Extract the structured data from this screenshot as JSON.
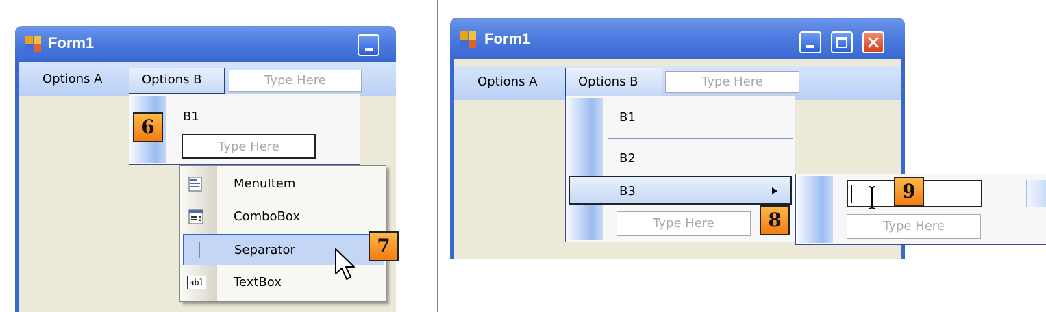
{
  "left_panel": {
    "window_title": "Form1",
    "menubar": {
      "options_a": "Options A",
      "options_b": "Options B",
      "type_here": "Type Here"
    },
    "dropdown": {
      "b1": "B1",
      "type_here": "Type Here"
    },
    "context_menu": {
      "items": [
        "MenuItem",
        "ComboBox",
        "Separator",
        "TextBox"
      ],
      "selected": "Separator"
    },
    "badges": {
      "step6": "6",
      "step7": "7"
    }
  },
  "right_panel": {
    "window_title": "Form1",
    "menubar": {
      "options_a": "Options A",
      "options_b": "Options B",
      "type_here": "Type Here"
    },
    "dropdown": {
      "b1": "B1",
      "b2": "B2",
      "b3": "B3",
      "type_here": "Type Here"
    },
    "submenu": {
      "edit_value": "",
      "type_here": "Type Here"
    },
    "badges": {
      "step8": "8",
      "step9": "9"
    }
  },
  "icons": [
    "app-icon",
    "minimize-icon",
    "maximize-icon",
    "close-icon",
    "menuitem-icon",
    "combobox-icon",
    "separator-icon",
    "textbox-icon",
    "submenu-arrow-icon",
    "mouse-pointer-icon",
    "text-cursor-icon"
  ],
  "colors": {
    "titlebar": "#3a68d2",
    "menubar": "#c6d9f6",
    "client": "#ece9d8",
    "badge": "#f27c10",
    "selection_border": "#2c3e7a"
  }
}
